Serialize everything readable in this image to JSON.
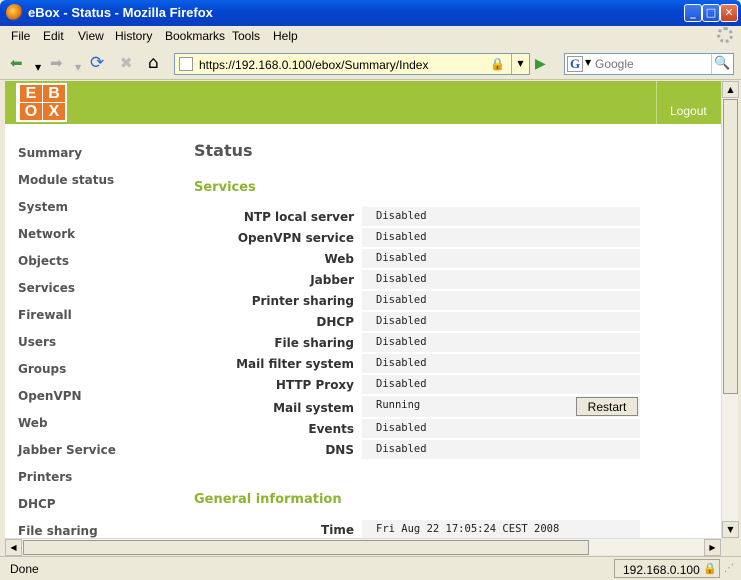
{
  "window": {
    "title": "eBox - Status - Mozilla Firefox",
    "minimize_glyph": "_",
    "maximize_glyph": "□",
    "close_glyph": "✕"
  },
  "menu": [
    "File",
    "Edit",
    "View",
    "History",
    "Bookmarks",
    "Tools",
    "Help"
  ],
  "nav": {
    "back_glyph": "⬅",
    "forward_glyph": "➡",
    "reload_glyph": "⟳",
    "stop_glyph": "✖",
    "home_glyph": "⌂",
    "url": "https://192.168.0.100/ebox/Summary/Index",
    "search_engine_letter": "G",
    "search_placeholder": "Google"
  },
  "header": {
    "logo_letters": [
      "E",
      "B",
      "O",
      "X"
    ],
    "logout_label": "Logout"
  },
  "sidebar": [
    "Summary",
    "Module status",
    "System",
    "Network",
    "Objects",
    "Services",
    "Firewall",
    "Users",
    "Groups",
    "OpenVPN",
    "Web",
    "Jabber Service",
    "Printers",
    "DHCP",
    "File sharing"
  ],
  "page_title": "Status",
  "services_title": "Services",
  "services": [
    {
      "label": "NTP local server",
      "value": "Disabled"
    },
    {
      "label": "OpenVPN service",
      "value": "Disabled"
    },
    {
      "label": "Web",
      "value": "Disabled"
    },
    {
      "label": "Jabber",
      "value": "Disabled"
    },
    {
      "label": "Printer sharing",
      "value": "Disabled"
    },
    {
      "label": "DHCP",
      "value": "Disabled"
    },
    {
      "label": "File sharing",
      "value": "Disabled"
    },
    {
      "label": "Mail filter system",
      "value": "Disabled"
    },
    {
      "label": "HTTP Proxy",
      "value": "Disabled"
    },
    {
      "label": "Mail system",
      "value": "Running",
      "action": "Restart"
    },
    {
      "label": "Events",
      "value": "Disabled"
    },
    {
      "label": "DNS",
      "value": "Disabled"
    }
  ],
  "general_title": "General information",
  "general": {
    "label": "Time",
    "value": "Fri Aug 22 17:05:24 CEST 2008"
  },
  "status": {
    "text": "Done",
    "host": "192.168.0.100"
  },
  "colors": {
    "brand_green": "#9fc33a",
    "logo_orange": "#e8792a",
    "section_green": "#8db430"
  }
}
